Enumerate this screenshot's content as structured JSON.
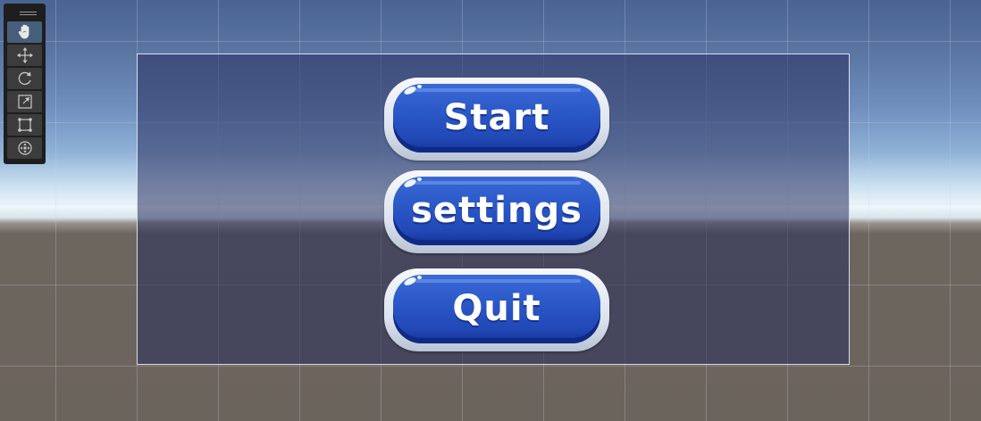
{
  "scene_view": {
    "tools": [
      {
        "name": "hand-tool",
        "icon": "hand-icon",
        "active": true
      },
      {
        "name": "move-tool",
        "icon": "move-arrows-icon",
        "active": false
      },
      {
        "name": "rotate-tool",
        "icon": "rotate-icon",
        "active": false
      },
      {
        "name": "scale-tool",
        "icon": "scale-icon",
        "active": false
      },
      {
        "name": "rect-tool",
        "icon": "rect-transform-icon",
        "active": false
      },
      {
        "name": "transform-tool",
        "icon": "transform-icon",
        "active": false
      }
    ],
    "colors": {
      "button_blue": "#2a56c6",
      "button_rim": "#e6eaf2",
      "canvas_outline": "#d9dee9",
      "toolbar_bg": "#1e1e1e",
      "active_tool": "#46607c"
    }
  },
  "menu": {
    "start_label": "Start",
    "settings_label": "settings",
    "quit_label": "Quit"
  }
}
